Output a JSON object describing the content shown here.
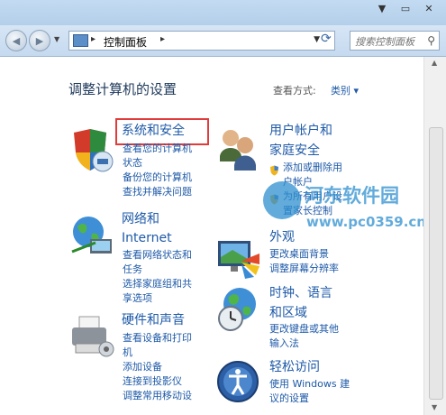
{
  "navbar": {
    "breadcrumb": "控制面板",
    "search_placeholder": "搜索控制面板"
  },
  "content": {
    "title": "调整计算机的设置",
    "view_by_label": "查看方式:",
    "view_by_value": "类别 ▾"
  },
  "categories": {
    "system_security": {
      "title": "系统和安全",
      "links": [
        "查看您的计算机",
        "状态",
        "备份您的计算机",
        "查找并解决问题"
      ]
    },
    "network": {
      "title_1": "网络和",
      "title_2": "Internet",
      "links": [
        "查看网络状态和",
        "任务",
        "选择家庭组和共",
        "享选项"
      ]
    },
    "hardware": {
      "title": "硬件和声音",
      "links": [
        "查看设备和打印",
        "机",
        "添加设备",
        "连接到投影仪",
        "调整常用移动设"
      ]
    },
    "user_accounts": {
      "title_1": "用户帐户和",
      "title_2": "家庭安全",
      "links": [
        "添加或删除用",
        "户帐户",
        "为所有用户设",
        "置家长控制"
      ]
    },
    "appearance": {
      "title": "外观",
      "links": [
        "更改桌面背景",
        "调整屏幕分辨率"
      ]
    },
    "clock": {
      "title_1": "时钟、语言",
      "title_2": "和区域",
      "links": [
        "更改键盘或其他",
        "输入法"
      ]
    },
    "ease": {
      "title": "轻松访问",
      "links": [
        "使用 Windows 建",
        "议的设置"
      ]
    }
  },
  "watermark": {
    "title": "河东软件园",
    "url": "www.pc0359.cn"
  },
  "colors": {
    "link": "#1e5aa8",
    "highlight_box": "#e23b3b",
    "title_text": "#1e395b"
  }
}
